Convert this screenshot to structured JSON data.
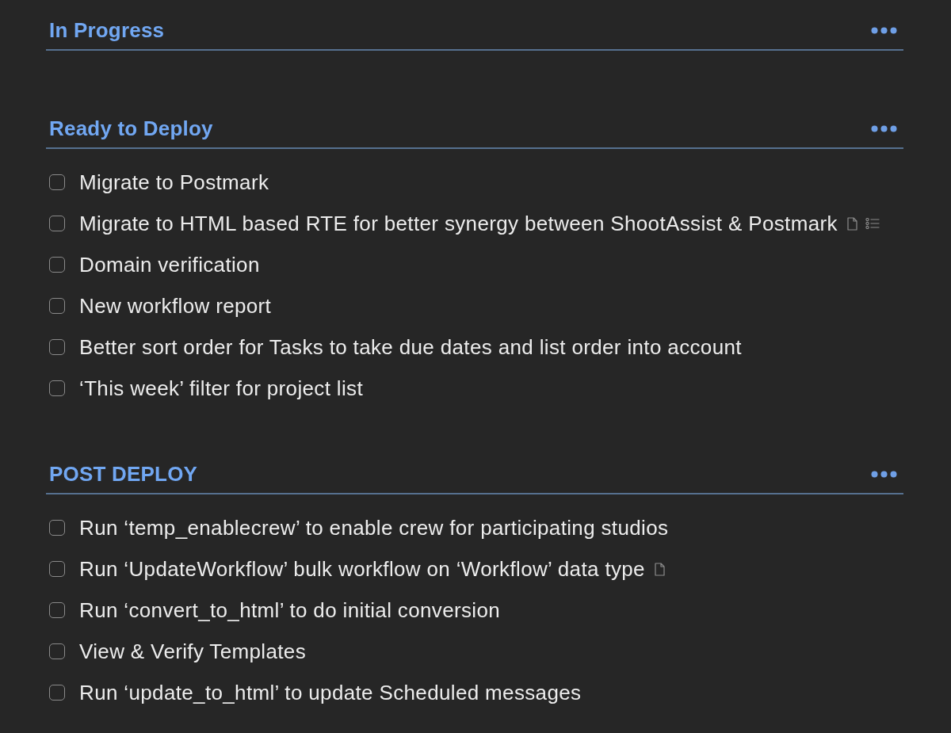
{
  "sections": [
    {
      "title": "In Progress"
    },
    {
      "title": "Ready to Deploy",
      "items": [
        {
          "text": "Migrate to Postmark",
          "checked": false,
          "has_note": false,
          "has_checklist": false
        },
        {
          "text": "Migrate to HTML based RTE for better synergy between ShootAssist & Postmark",
          "checked": false,
          "has_note": true,
          "has_checklist": true
        },
        {
          "text": "Domain verification",
          "checked": false,
          "has_note": false,
          "has_checklist": false
        },
        {
          "text": "New workflow report",
          "checked": false,
          "has_note": false,
          "has_checklist": false
        },
        {
          "text": "Better sort order for Tasks to take due dates and list order into account",
          "checked": false,
          "has_note": false,
          "has_checklist": false
        },
        {
          "text": "‘This week’ filter for project list",
          "checked": false,
          "has_note": false,
          "has_checklist": false
        }
      ]
    },
    {
      "title": "POST DEPLOY",
      "items": [
        {
          "text": "Run ‘temp_enablecrew’ to enable crew for participating studios",
          "checked": false,
          "has_note": false,
          "has_checklist": false
        },
        {
          "text": "Run ‘UpdateWorkflow’ bulk workflow on ‘Workflow’ data type",
          "checked": false,
          "has_note": true,
          "has_checklist": false
        },
        {
          "text": "Run ‘convert_to_html’ to do initial conversion",
          "checked": false,
          "has_note": false,
          "has_checklist": false
        },
        {
          "text": "View & Verify Templates",
          "checked": false,
          "has_note": false,
          "has_checklist": false
        },
        {
          "text": "Run ‘update_to_html’ to update Scheduled messages",
          "checked": false,
          "has_note": false,
          "has_checklist": false
        }
      ]
    }
  ]
}
